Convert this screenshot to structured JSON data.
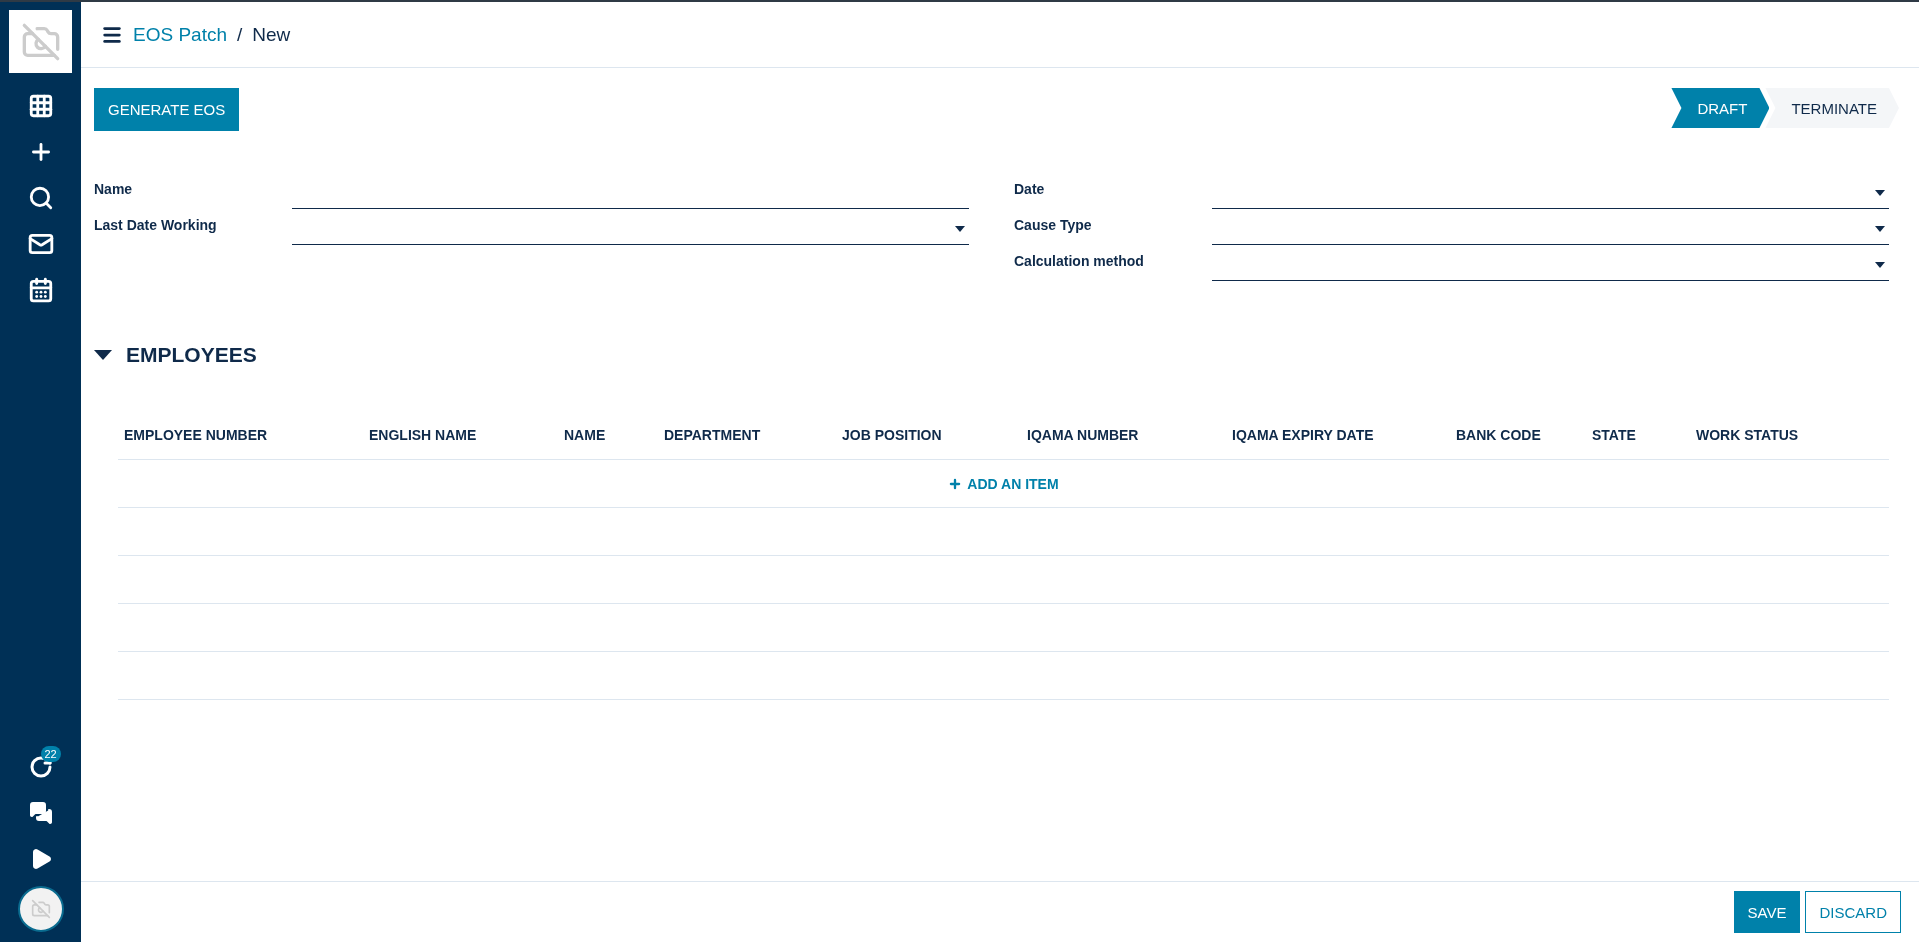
{
  "sidebar": {
    "badge": "22"
  },
  "breadcrumb": {
    "parent": "EOS Patch",
    "separator": "/",
    "current": "New"
  },
  "actions": [
    "GENERATE EOS"
  ],
  "stages": [
    {
      "label": "DRAFT",
      "selected": true
    },
    {
      "label": "TERMINATE",
      "selected": false
    }
  ],
  "form": {
    "left": [
      {
        "label": "Name",
        "kind": "text"
      },
      {
        "label": "Last Date Working",
        "kind": "select"
      }
    ],
    "right": [
      {
        "label": "Date",
        "kind": "select"
      },
      {
        "label": "Cause Type",
        "kind": "select"
      },
      {
        "label": "Calculation method",
        "kind": "select"
      }
    ]
  },
  "section": {
    "title": "EMPLOYEES",
    "expanded": true
  },
  "table": {
    "columns": [
      "EMPLOYEE NUMBER",
      "ENGLISH NAME",
      "NAME",
      "DEPARTMENT",
      "JOB POSITION",
      "IQAMA NUMBER",
      "IQAMA EXPIRY DATE",
      "BANK CODE",
      "STATE",
      "WORK STATUS"
    ],
    "add_item": "ADD AN ITEM"
  },
  "footer": {
    "buttons": [
      {
        "label": "SAVE",
        "kind": "primary"
      },
      {
        "label": "DISCARD",
        "kind": "secondary"
      }
    ]
  }
}
